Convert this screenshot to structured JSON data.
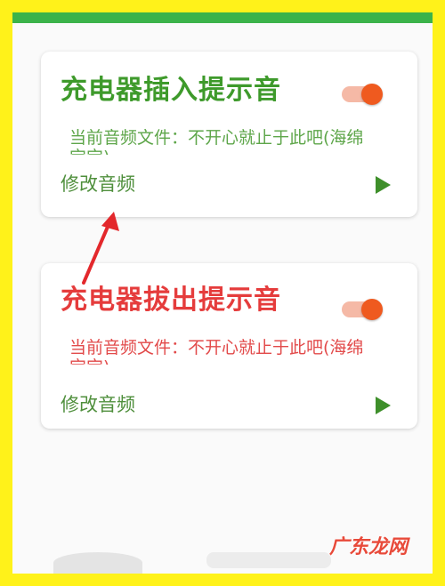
{
  "cards": [
    {
      "title": "充电器插入提示音",
      "toggle_on": true,
      "file_label": "当前音频文件：不开心就止于此吧(海绵宝宝)",
      "modify_label": "修改音频",
      "title_color": "#3e9a2b"
    },
    {
      "title": "充电器拔出提示音",
      "toggle_on": true,
      "file_label": "当前音频文件：不开心就止于此吧(海绵宝宝)",
      "modify_label": "修改音频",
      "title_color": "#e53c3c"
    }
  ],
  "colors": {
    "frame_border": "#fff21a",
    "top_strip": "#3bb34a",
    "toggle_knob": "#ef5a1f",
    "annotation_arrow": "#e3282c"
  },
  "icons": [
    "play-icon",
    "toggle-switch",
    "annotation-arrow"
  ],
  "watermark": "广东龙网"
}
